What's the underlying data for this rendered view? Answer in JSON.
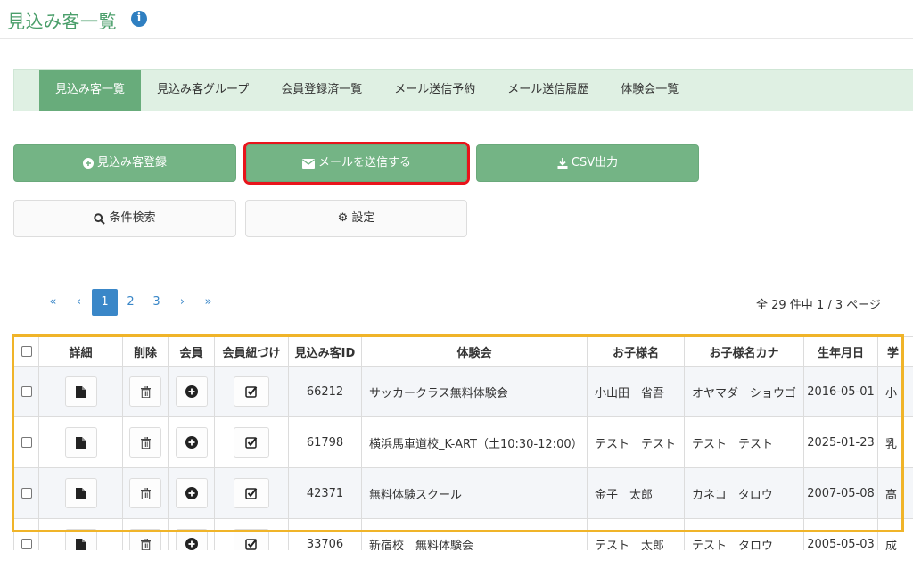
{
  "header": {
    "title": "見込み客一覧",
    "info_icon": "i"
  },
  "tabs": [
    {
      "label": "見込み客一覧",
      "active": true
    },
    {
      "label": "見込み客グループ",
      "active": false
    },
    {
      "label": "会員登録済一覧",
      "active": false
    },
    {
      "label": "メール送信予約",
      "active": false
    },
    {
      "label": "メール送信履歴",
      "active": false
    },
    {
      "label": "体験会一覧",
      "active": false
    }
  ],
  "actions": {
    "register": {
      "label": "見込み客登録",
      "icon": "plus-circle-icon"
    },
    "send_mail": {
      "label": "メールを送信する",
      "icon": "envelope-icon"
    },
    "csv": {
      "label": "CSV出力",
      "icon": "download-icon"
    },
    "search": {
      "label": "条件検索",
      "icon": "search-icon"
    },
    "settings": {
      "label": "設定",
      "icon": "gear-icon"
    }
  },
  "pagination": {
    "first": "«",
    "prev": "‹",
    "pages": [
      "1",
      "2",
      "3"
    ],
    "current": "1",
    "next": "›",
    "last": "»",
    "summary": "全 29 件中 1 / 3 ページ"
  },
  "table": {
    "headers": [
      "詳細",
      "削除",
      "会員",
      "会員紐づけ",
      "見込み客ID",
      "体験会",
      "お子様名",
      "お子様名カナ",
      "生年月日",
      "学"
    ],
    "rows": [
      {
        "id": "66212",
        "event": "サッカークラス無料体験会",
        "name": "小山田　省吾",
        "kana": "オヤマダ　ショウゴ",
        "birth": "2016-05-01",
        "grade": "小"
      },
      {
        "id": "61798",
        "event": "横浜馬車道校_K-ART（土10:30-12:00）",
        "name": "テスト　テスト",
        "kana": "テスト　テスト",
        "birth": "2025-01-23",
        "grade": "乳"
      },
      {
        "id": "42371",
        "event": "無料体験スクール",
        "name": "金子　太郎",
        "kana": "カネコ　タロウ",
        "birth": "2007-05-08",
        "grade": "高"
      },
      {
        "id": "33706",
        "event": "新宿校　無料体験会",
        "name": "テスト　太郎",
        "kana": "テスト　タロウ",
        "birth": "2005-05-03",
        "grade": "成"
      }
    ]
  },
  "colors": {
    "accent": "#68ac7b",
    "link": "#3a87c8",
    "highlight_red": "#e8141b",
    "highlight_yellow": "#f0b429"
  }
}
